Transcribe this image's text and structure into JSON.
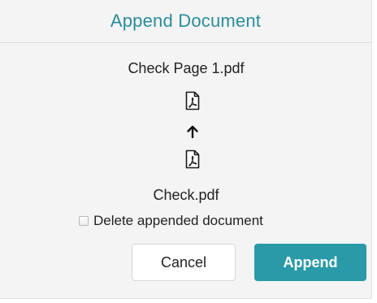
{
  "dialog": {
    "title": "Append Document",
    "target_file": {
      "name": "Check Page 1.pdf",
      "icon": "pdf-file-icon"
    },
    "direction_icon": "arrow-up-icon",
    "source_file": {
      "name": "Check.pdf",
      "icon": "pdf-file-icon"
    },
    "delete_option": {
      "label": "Delete appended document",
      "checked": false
    },
    "buttons": {
      "cancel_label": "Cancel",
      "append_label": "Append"
    },
    "colors": {
      "accent": "#2a9aa9",
      "title": "#2a8d9c"
    }
  }
}
